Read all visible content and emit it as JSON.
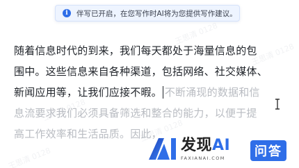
{
  "toast": {
    "icon": "info-icon",
    "icon_glyph": "i",
    "message": "伴写已开启，在您写作时AI将为您提供写作建议。"
  },
  "editor": {
    "line1": "随着信息时代的到来，我们每天都处于海量信息的包",
    "line2": "围中。这些信息来自各种渠道，包括网络、社交媒体、",
    "line3_typed": "新闻应用等，让我们应接不暇。",
    "line3_suggestion": "不断涌现的数据和信",
    "line4_suggestion": "息流要求我们必须具备筛选和整合的能力，以便于提",
    "line5_suggestion": "高工作效率和生活品质。因此，"
  },
  "watermark": {
    "text": "王思清 0128"
  },
  "brand": {
    "name_prefix": "发现",
    "name_ai": "AI",
    "domain": "FAXIANAI.COM",
    "badge": "问答",
    "accent_color": "#2f6ee8"
  }
}
